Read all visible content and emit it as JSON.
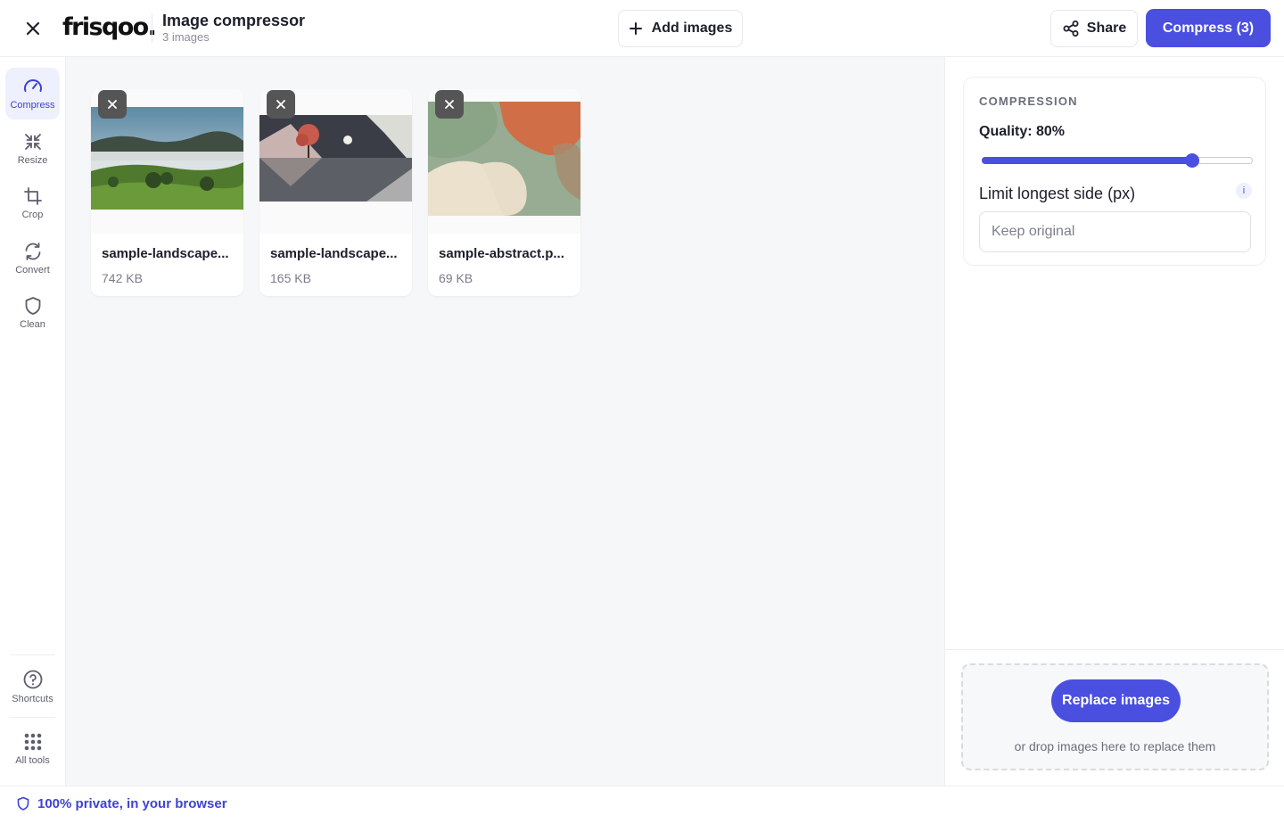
{
  "header": {
    "logo": "frisqoo.",
    "title": "Image compressor",
    "subtitle": "3 images",
    "add_label": "Add images",
    "share_label": "Share",
    "compress_label": "Compress (3)"
  },
  "rail": {
    "items": [
      {
        "label": "Compress",
        "icon": "gauge-icon",
        "active": true
      },
      {
        "label": "Resize",
        "icon": "resize-icon"
      },
      {
        "label": "Crop",
        "icon": "crop-icon"
      },
      {
        "label": "Convert",
        "icon": "convert-icon"
      },
      {
        "label": "Clean",
        "icon": "shield-icon"
      }
    ],
    "bottom": [
      {
        "label": "Shortcuts",
        "icon": "question-icon"
      },
      {
        "label": "All tools",
        "icon": "grid-icon"
      }
    ]
  },
  "images": [
    {
      "name": "sample-landscape...",
      "size": "742 KB"
    },
    {
      "name": "sample-landscape...",
      "size": "165 KB"
    },
    {
      "name": "sample-abstract.p...",
      "size": "69 KB"
    }
  ],
  "settings": {
    "section_title": "COMPRESSION",
    "quality_label": "Quality: 80%",
    "quality_value": 80,
    "limit_label": "Limit longest side (px)",
    "info_label": "i",
    "limit_placeholder": "Keep original",
    "limit_value": ""
  },
  "dropzone": {
    "button_label": "Replace images",
    "hint": "or drop images here to replace them"
  },
  "footer": {
    "privacy": "100% private, in your browser"
  },
  "colors": {
    "accent": "#4a4fe0",
    "accent_text": "#3e43d1",
    "canvas_bg": "#f6f7f9"
  }
}
